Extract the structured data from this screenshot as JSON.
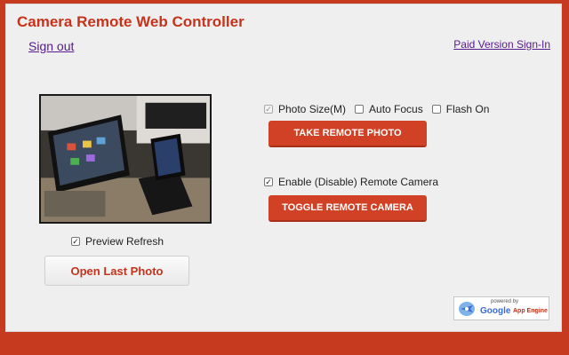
{
  "header": {
    "title": "Camera Remote Web Controller"
  },
  "links": {
    "sign_out": "Sign out",
    "paid_signin": "Paid Version Sign-In"
  },
  "preview": {
    "refresh_label": "Preview Refresh",
    "refresh_checked": true,
    "open_last_label": "Open Last Photo"
  },
  "options": {
    "photo_size": {
      "label": "Photo Size(M)",
      "checked": true,
      "disabled": true
    },
    "auto_focus": {
      "label": "Auto Focus",
      "checked": false
    },
    "flash_on": {
      "label": "Flash On",
      "checked": false
    },
    "take_photo_label": "TAKE REMOTE PHOTO",
    "enable_camera": {
      "label": "Enable (Disable) Remote Camera",
      "checked": true
    },
    "toggle_camera_label": "TOGGLE REMOTE CAMERA"
  },
  "badge": {
    "powered": "powered by",
    "google": "Google",
    "appengine": "App Engine",
    "icon": "app-engine-jet-icon"
  },
  "colors": {
    "accent": "#c8321a",
    "button": "#d14125",
    "outer": "#c63a1f",
    "panel": "#efefef"
  }
}
